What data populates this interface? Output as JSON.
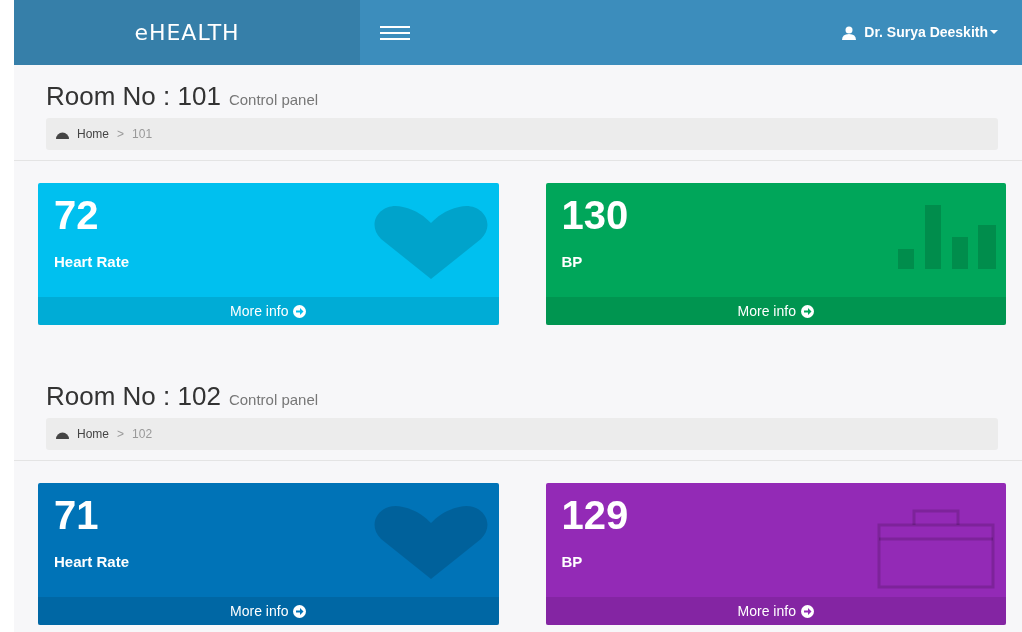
{
  "navbar": {
    "logo": "eHEALTH",
    "user": "Dr. Surya Deeskith"
  },
  "rooms": [
    {
      "title": "Room No : 101",
      "subtitle": "Control panel",
      "breadcrumb": [
        "Home",
        "101"
      ],
      "separator": ">",
      "cards": [
        {
          "value": "72",
          "label": "Heart Rate",
          "link": "More info",
          "kind": "heart",
          "color": "#00c0ef"
        },
        {
          "value": "130",
          "label": "BP",
          "link": "More info",
          "kind": "bars",
          "color": "#00a65a"
        }
      ]
    },
    {
      "title": "Room No : 102",
      "subtitle": "Control panel",
      "breadcrumb": [
        "Home",
        "102"
      ],
      "separator": ">",
      "cards": [
        {
          "value": "71",
          "label": "Heart Rate",
          "link": "More info",
          "kind": "heart",
          "color": "#0073b7"
        },
        {
          "value": "129",
          "label": "BP",
          "link": "More info",
          "kind": "briefcase",
          "color": "#932ab6"
        }
      ]
    }
  ]
}
